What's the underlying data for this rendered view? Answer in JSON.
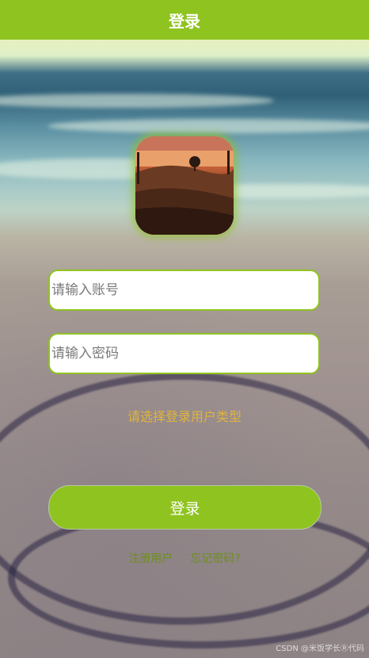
{
  "header": {
    "title": "登录"
  },
  "form": {
    "account_placeholder": "请输入账号",
    "password_placeholder": "请输入密码",
    "user_type_label": "请选择登录用户类型",
    "login_label": "登录"
  },
  "links": {
    "register_label": "注册用户",
    "forgot_label": "忘记密码?"
  },
  "watermark": "CSDN @米饭学长Ⓡ代码",
  "colors": {
    "accent": "#8fc31f",
    "user_type_text": "#e0b43a",
    "link_text": "#6d8f1c"
  }
}
